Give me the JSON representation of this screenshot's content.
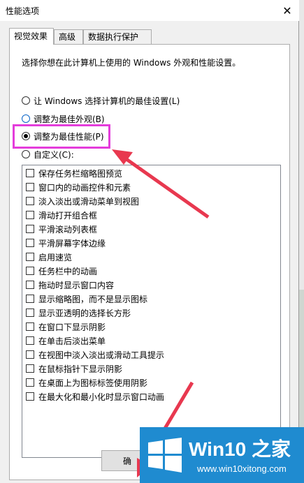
{
  "window": {
    "title": "性能选项",
    "close_icon": "close-icon"
  },
  "tabs": [
    {
      "label": "视觉效果",
      "active": true
    },
    {
      "label": "高级",
      "active": false
    },
    {
      "label": "数据执行保护",
      "active": false
    }
  ],
  "description": "选择你想在此计算机上使用的 Windows 外观和性能设置。",
  "radios": [
    {
      "label": "让 Windows 选择计算机的最佳设置(L)",
      "checked": false
    },
    {
      "label": "调整为最佳外观(B)",
      "checked": false
    },
    {
      "label": "调整为最佳性能(P)",
      "checked": true
    },
    {
      "label": "自定义(C):",
      "checked": false
    }
  ],
  "effects": [
    "保存任务栏缩略图预览",
    "窗口内的动画控件和元素",
    "淡入淡出或滑动菜单到视图",
    "滑动打开组合框",
    "平滑滚动列表框",
    "平滑屏幕字体边缘",
    "启用速览",
    "任务栏中的动画",
    "拖动时显示窗口内容",
    "显示缩略图，而不是显示图标",
    "显示亚透明的选择长方形",
    "在窗口下显示阴影",
    "在单击后淡出菜单",
    "在视图中淡入淡出或滑动工具提示",
    "在鼠标指针下显示阴影",
    "在桌面上为图标标签使用阴影",
    "在最大化和最小化时显示窗口动画"
  ],
  "buttons": {
    "ok_label": "确"
  },
  "watermark": {
    "title": "Win10 之家",
    "url": "www.win10xitong.com"
  },
  "colors": {
    "highlight": "#e43ddb",
    "arrow": "#e8384f",
    "watermark_bg": "#1f8bd0"
  }
}
